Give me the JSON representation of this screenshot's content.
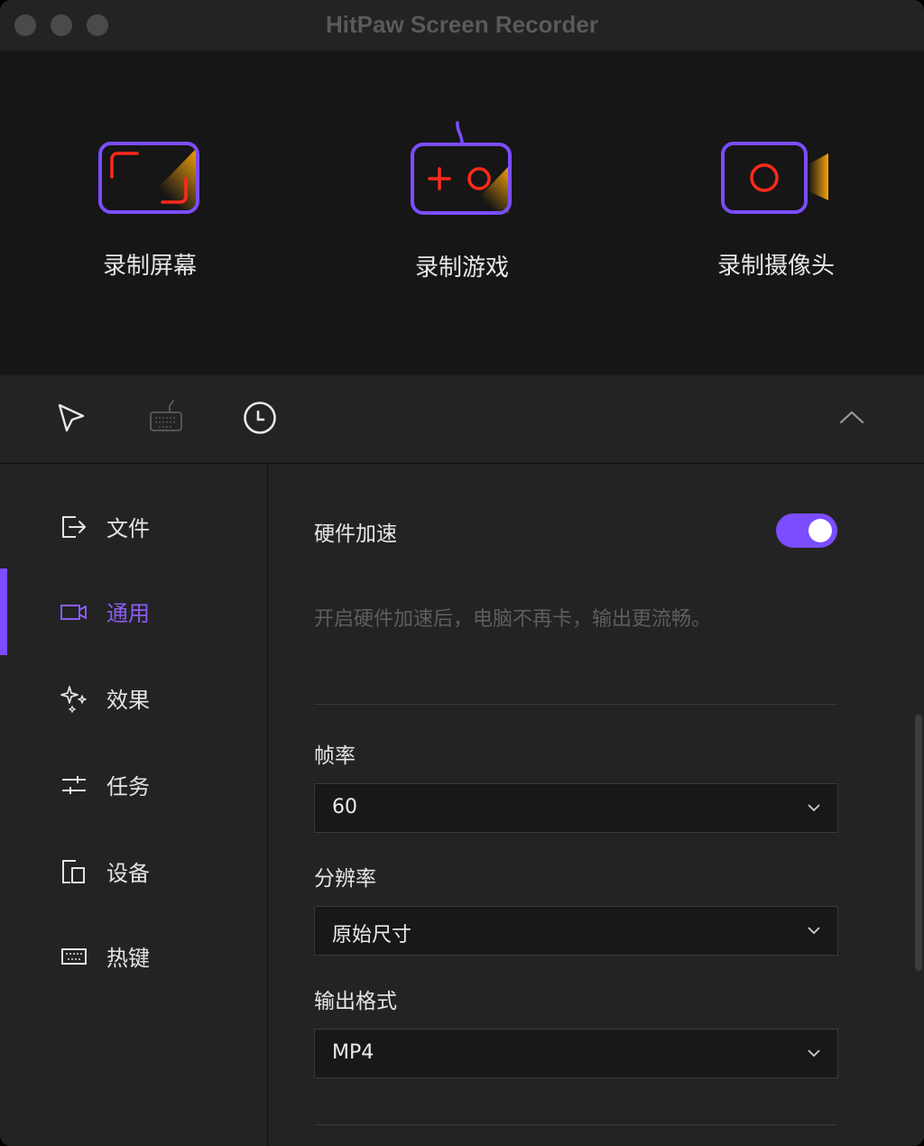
{
  "window": {
    "title": "HitPaw Screen Recorder"
  },
  "modes": [
    {
      "label": "录制屏幕",
      "icon": "screen-record-icon"
    },
    {
      "label": "录制游戏",
      "icon": "game-record-icon"
    },
    {
      "label": "录制摄像头",
      "icon": "webcam-record-icon"
    }
  ],
  "toolbar": {
    "icons": [
      "cursor-icon",
      "keyboard-icon",
      "clock-icon",
      "chevron-up-icon"
    ]
  },
  "sidebar": {
    "items": [
      {
        "label": "文件",
        "icon": "export-icon"
      },
      {
        "label": "通用",
        "icon": "video-camera-icon",
        "active": true
      },
      {
        "label": "效果",
        "icon": "sparkle-icon"
      },
      {
        "label": "任务",
        "icon": "sliders-icon"
      },
      {
        "label": "设备",
        "icon": "devices-icon"
      },
      {
        "label": "热键",
        "icon": "keyboard-icon"
      }
    ]
  },
  "settings": {
    "hardware_accel": {
      "label": "硬件加速",
      "enabled": true,
      "hint": "开启硬件加速后，电脑不再卡，输出更流畅。"
    },
    "frame_rate": {
      "label": "帧率",
      "value": "60"
    },
    "resolution": {
      "label": "分辨率",
      "value": "原始尺寸"
    },
    "output_format": {
      "label": "输出格式",
      "value": "MP4"
    }
  },
  "colors": {
    "accent": "#7b4dff",
    "record_red": "#ff2a1a",
    "orange": "#f5a20a",
    "background": "#232323",
    "hero_bg": "#161616"
  }
}
